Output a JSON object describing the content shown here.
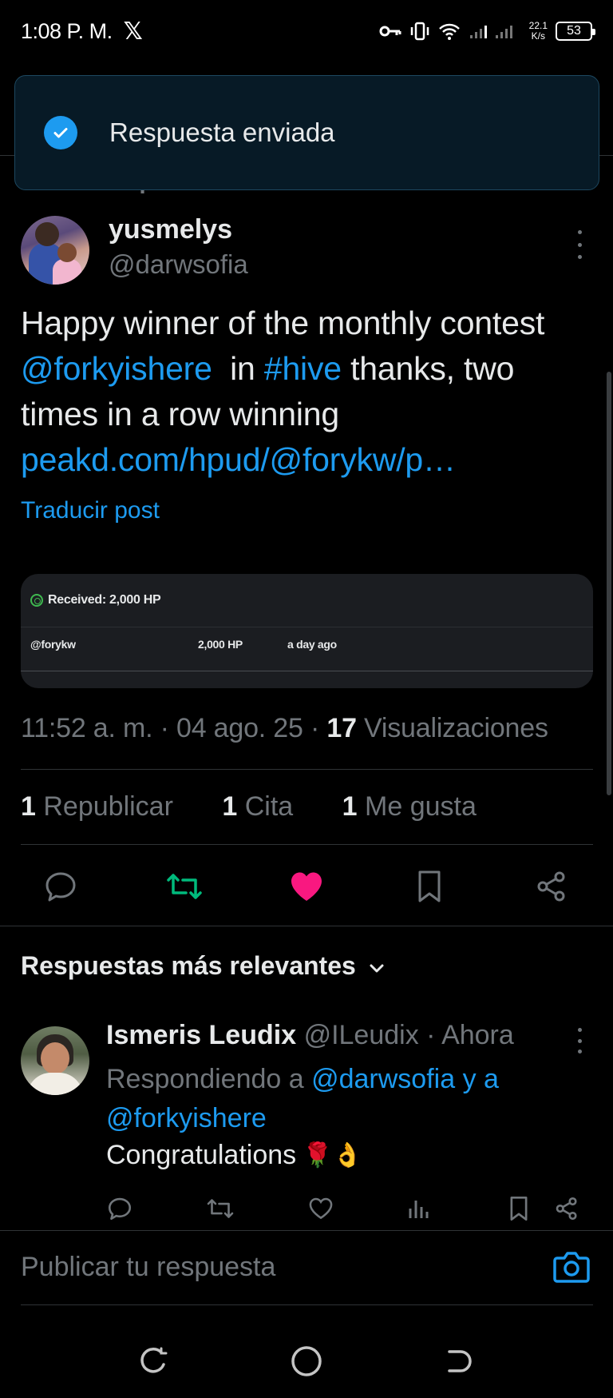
{
  "status_bar": {
    "time": "1:08 P. M.",
    "app_glyph": "𝕏",
    "net_speed_value": "22.1",
    "net_speed_unit": "K/s",
    "battery": "53"
  },
  "toast": {
    "text": "Respuesta enviada"
  },
  "reposted_label": "Reposteaste",
  "tweet": {
    "author_name": "yusmelys",
    "author_handle": "@darwsofia",
    "text_1": "Happy winner of the monthly contest ",
    "mention": "@forkyishere",
    "text_2": "  in ",
    "hashtag": "#hive",
    "text_3": " thanks, two times in a row winning ",
    "url": "peakd.com/hpud/@forykw/p…",
    "translate_label": "Traducir post",
    "media": {
      "title": "Received: 2,000 HP",
      "row_from": "@forykw",
      "row_amount": "2,000 HP",
      "row_time": "a day ago"
    },
    "time": "11:52 a. m.",
    "date": "04 ago. 25",
    "views_count": "17",
    "views_label": "Visualizaciones",
    "reposts_count": "1",
    "reposts_label": "Republicar",
    "quotes_count": "1",
    "quotes_label": "Cita",
    "likes_count": "1",
    "likes_label": "Me gusta",
    "liked": true
  },
  "replies_section": {
    "title": "Respuestas más relevantes"
  },
  "reply": {
    "author_name": "Ismeris Leudix",
    "author_handle": "@ILeudix",
    "time": "Ahora",
    "replying_prefix": "Respondiendo a ",
    "replying_targets": "@darwsofia y a @forkyishere",
    "text": "Congratulations",
    "emoji": "🌹👌"
  },
  "compose": {
    "placeholder": "Publicar tu respuesta"
  },
  "colors": {
    "accent": "#1d9bf0",
    "like": "#f91880",
    "repost": "#00ba7c",
    "muted": "#71767b"
  }
}
